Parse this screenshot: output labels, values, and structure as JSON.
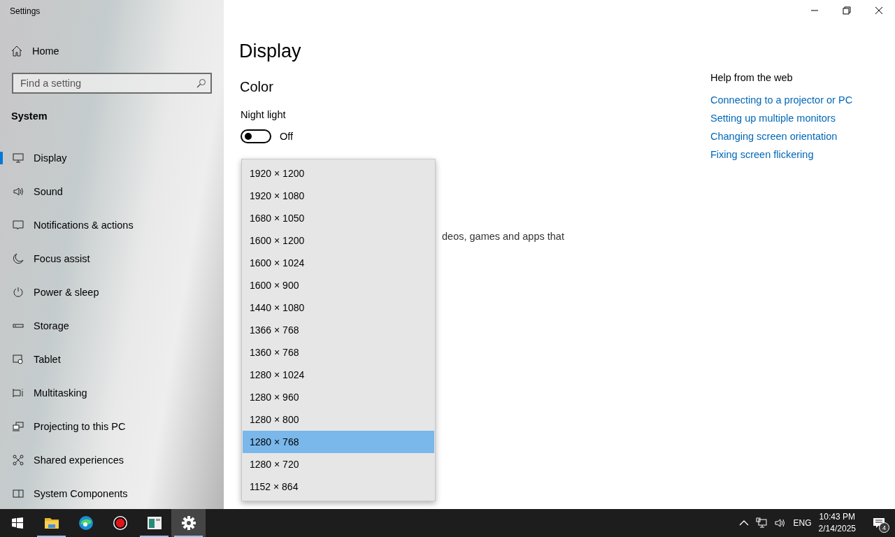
{
  "window": {
    "title": "Settings"
  },
  "sidebar": {
    "home": "Home",
    "search": {
      "placeholder": "Find a setting"
    },
    "section": "System",
    "items": [
      {
        "label": "Display",
        "kind": "display",
        "selected": true
      },
      {
        "label": "Sound",
        "kind": "sound",
        "selected": false
      },
      {
        "label": "Notifications & actions",
        "kind": "notifications",
        "selected": false
      },
      {
        "label": "Focus assist",
        "kind": "moon",
        "selected": false
      },
      {
        "label": "Power & sleep",
        "kind": "power",
        "selected": false
      },
      {
        "label": "Storage",
        "kind": "storage",
        "selected": false
      },
      {
        "label": "Tablet",
        "kind": "tablet",
        "selected": false
      },
      {
        "label": "Multitasking",
        "kind": "multitasking",
        "selected": false
      },
      {
        "label": "Projecting to this PC",
        "kind": "projecting",
        "selected": false
      },
      {
        "label": "Shared experiences",
        "kind": "shared",
        "selected": false
      },
      {
        "label": "System Components",
        "kind": "components",
        "selected": false
      }
    ]
  },
  "page": {
    "title": "Display",
    "section": "Color",
    "night_light": {
      "label": "Night light",
      "on": false,
      "state": "Off"
    },
    "fragment": "deos, games and apps that"
  },
  "dropdown": {
    "options": [
      {
        "label": "1920 × 1200",
        "selected": false
      },
      {
        "label": "1920 × 1080",
        "selected": false
      },
      {
        "label": "1680 × 1050",
        "selected": false
      },
      {
        "label": "1600 × 1200",
        "selected": false
      },
      {
        "label": "1600 × 1024",
        "selected": false
      },
      {
        "label": "1600 × 900",
        "selected": false
      },
      {
        "label": "1440 × 1080",
        "selected": false
      },
      {
        "label": "1366 × 768",
        "selected": false
      },
      {
        "label": "1360 × 768",
        "selected": false
      },
      {
        "label": "1280 × 1024",
        "selected": false
      },
      {
        "label": "1280 × 960",
        "selected": false
      },
      {
        "label": "1280 × 800",
        "selected": false
      },
      {
        "label": "1280 × 768",
        "selected": true
      },
      {
        "label": "1280 × 720",
        "selected": false
      },
      {
        "label": "1152 × 864",
        "selected": false
      }
    ]
  },
  "help": {
    "title": "Help from the web",
    "links": [
      "Connecting to a projector or PC",
      "Setting up multiple monitors",
      "Changing screen orientation",
      "Fixing screen flickering"
    ]
  },
  "taskbar": {
    "apps": [
      {
        "kind": "explorer",
        "running": true,
        "selected": false
      },
      {
        "kind": "browser",
        "running": false,
        "selected": false
      },
      {
        "kind": "recorder",
        "running": false,
        "selected": false
      },
      {
        "kind": "viewer",
        "running": true,
        "selected": false
      },
      {
        "kind": "settings",
        "running": true,
        "selected": true
      }
    ],
    "tray": {
      "language": "ENG",
      "time": "10:43 PM",
      "date": "2/14/2025",
      "notifications": "4"
    }
  }
}
